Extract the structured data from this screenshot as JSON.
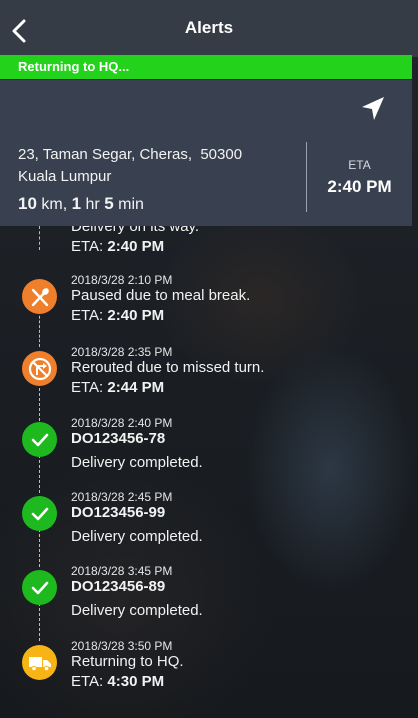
{
  "header": {
    "title": "Alerts",
    "back_icon": "chevron-left-icon"
  },
  "status": {
    "text": "Returning to HQ...",
    "color": "#23d21b"
  },
  "destination": {
    "address_line1": "23, Taman Segar, Cheras,  50300",
    "address_line2": "Kuala Lumpur",
    "distance_value": "10",
    "distance_unit": "km,",
    "hours_value": "1",
    "hours_unit": "hr",
    "minutes_value": "5",
    "minutes_unit": "min",
    "eta_label": "ETA",
    "eta_value": "2:40 PM",
    "nav_icon": "navigation-arrow-icon"
  },
  "timeline": {
    "partial": {
      "message": "Delivery on its way.",
      "eta_label": "ETA:",
      "eta_value": "2:40 PM"
    },
    "events": [
      {
        "icon": "utensils-icon",
        "icon_color": "#f07f2c",
        "time": "2018/3/28 2:10 PM",
        "message": "Paused due to meal break.",
        "eta_label": "ETA:",
        "eta_value": "2:40 PM"
      },
      {
        "icon": "no-right-turn-icon",
        "icon_color": "#f07f2c",
        "time": "2018/3/28 2:35 PM",
        "message": "Rerouted due to missed turn.",
        "eta_label": "ETA:",
        "eta_value": "2:44 PM"
      },
      {
        "icon": "checkmark-icon",
        "icon_color": "#1eb91e",
        "time": "2018/3/28 2:40 PM",
        "order": "DO123456-78",
        "message": "Delivery completed."
      },
      {
        "icon": "checkmark-icon",
        "icon_color": "#1eb91e",
        "time": "2018/3/28 2:45 PM",
        "order": "DO123456-99",
        "message": "Delivery completed."
      },
      {
        "icon": "checkmark-icon",
        "icon_color": "#1eb91e",
        "time": "2018/3/28 3:45 PM",
        "order": "DO123456-89",
        "message": "Delivery completed."
      },
      {
        "icon": "truck-icon",
        "icon_color": "#f6b514",
        "time": "2018/3/28 3:50 PM",
        "message": "Returning to HQ.",
        "eta_label": "ETA:",
        "eta_value": "4:30 PM"
      }
    ]
  }
}
